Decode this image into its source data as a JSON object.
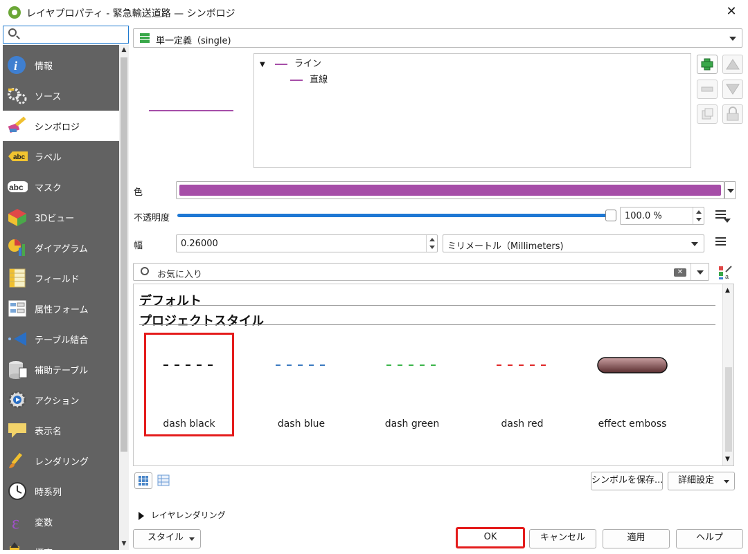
{
  "window": {
    "title": "レイヤプロパティ - 緊急輸送道路 — シンボロジ",
    "close": "✕"
  },
  "sidebar": {
    "search_placeholder": "",
    "items": [
      {
        "label": "情報",
        "icon": "info-icon"
      },
      {
        "label": "ソース",
        "icon": "source-icon"
      },
      {
        "label": "シンボロジ",
        "icon": "symbology-icon",
        "active": true
      },
      {
        "label": "ラベル",
        "icon": "labels-icon"
      },
      {
        "label": "マスク",
        "icon": "mask-icon"
      },
      {
        "label": "3Dビュー",
        "icon": "3d-view-icon"
      },
      {
        "label": "ダイアグラム",
        "icon": "diagram-icon"
      },
      {
        "label": "フィールド",
        "icon": "fields-icon"
      },
      {
        "label": "属性フォーム",
        "icon": "attribute-form-icon"
      },
      {
        "label": "テーブル結合",
        "icon": "joins-icon"
      },
      {
        "label": "補助テーブル",
        "icon": "auxiliary-storage-icon"
      },
      {
        "label": "アクション",
        "icon": "actions-icon"
      },
      {
        "label": "表示名",
        "icon": "display-icon"
      },
      {
        "label": "レンダリング",
        "icon": "rendering-icon"
      },
      {
        "label": "時系列",
        "icon": "temporal-icon"
      },
      {
        "label": "変数",
        "icon": "variables-icon"
      },
      {
        "label": "標高",
        "icon": "elevation-icon"
      }
    ]
  },
  "renderer": {
    "value": "単一定義（single)"
  },
  "symbol_tree": {
    "root": "ライン",
    "child": "直線"
  },
  "color": {
    "label": "色",
    "value": "#a64ea8"
  },
  "opacity": {
    "label": "不透明度",
    "value": "100.0 %",
    "fraction": 1.0
  },
  "width": {
    "label": "幅",
    "value": "0.26000",
    "unit": "ミリメートル（Millimeters)"
  },
  "library": {
    "search_placeholder": "お気に入り",
    "groups": [
      "デフォルト",
      "プロジェクトスタイル"
    ],
    "symbols": [
      {
        "name": "dash  black",
        "color": "#111111",
        "selected": true
      },
      {
        "name": "dash blue",
        "color": "#3b7ac0"
      },
      {
        "name": "dash green",
        "color": "#3bb54a"
      },
      {
        "name": "dash red",
        "color": "#e02828"
      },
      {
        "name": "effect emboss",
        "color": "#7a4a4c"
      }
    ]
  },
  "buttons": {
    "save_symbol": "シンボルを保存...",
    "advanced": "詳細設定",
    "layer_rendering": "レイヤレンダリング",
    "style": "スタイル",
    "ok": "OK",
    "cancel": "キャンセル",
    "apply": "適用",
    "help": "ヘルプ"
  }
}
